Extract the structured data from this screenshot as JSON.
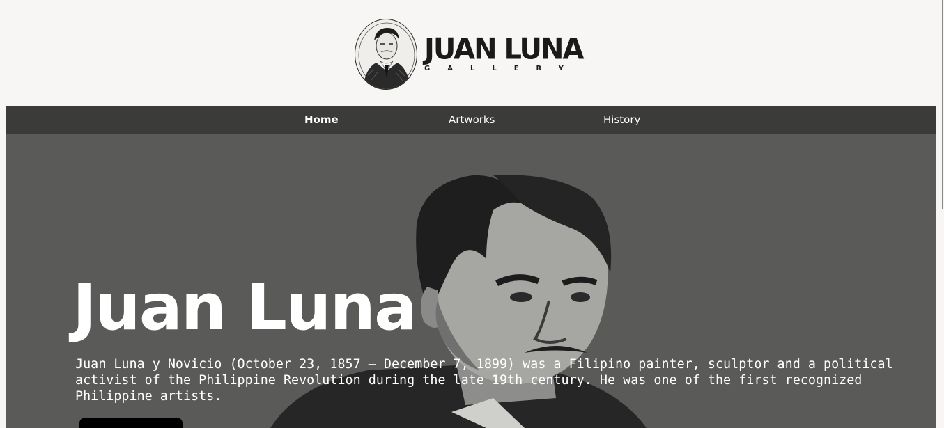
{
  "header": {
    "logo_title": "JUAN LUNA",
    "logo_subtitle": "GALLERY",
    "logo_icon": "portrait-engraving-icon"
  },
  "nav": {
    "items": [
      {
        "label": "Home",
        "active": true
      },
      {
        "label": "Artworks",
        "active": false
      },
      {
        "label": "History",
        "active": false
      }
    ]
  },
  "hero": {
    "title": "Juan Luna",
    "description": "Juan Luna y Novicio (October 23, 1857 – December 7, 1899) was a Filipino painter, sculptor and a political activist of the Philippine Revolution during the late 19th century. He was one of the first recognized Philippine artists.",
    "background_image": "juan-luna-portrait"
  },
  "colors": {
    "page_bg": "#f7f6f4",
    "nav_bg": "#3b3b39",
    "hero_bg": "#5a5a59",
    "text_light": "#ffffff",
    "logo_text": "#1a1a1a",
    "button_bg": "#000000"
  }
}
